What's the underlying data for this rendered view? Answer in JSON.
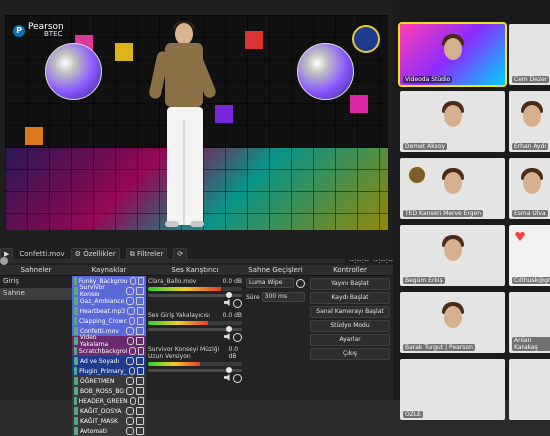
{
  "obs": {
    "logo_text": "Pearson",
    "logo_sub": "BTEC",
    "media_file": "Confetti.mov",
    "properties_label": "Özellikler",
    "filters_label": "Filtreler",
    "timer_left": "--:--:--",
    "timer_right": "--:--:--",
    "panels": {
      "scenes": {
        "title": "Sahneler",
        "items": [
          "Giriş",
          "Sahne"
        ]
      },
      "sources": {
        "title": "Kaynaklar",
        "items": [
          {
            "label": "Funky_Backgrou",
            "color": "#5c6ad9"
          },
          {
            "label": "Survivor Konseı",
            "color": "#5c6ad9"
          },
          {
            "label": "Gaz_Ambiance",
            "color": "#5c6ad9"
          },
          {
            "label": "Heartbeat.mp3",
            "color": "#5c6ad9"
          },
          {
            "label": "Clapping_Crowc",
            "color": "#5c6ad9"
          },
          {
            "label": "Confetti.mov",
            "color": "#5c6ad9"
          },
          {
            "label": "Video Yakalama",
            "color": "#6a2a6e"
          },
          {
            "label": "Scratchbackgroi",
            "color": "#6a2a6e"
          },
          {
            "label": "Ad ve Soyadı",
            "color": "#1e3b8f"
          },
          {
            "label": "Plugin_Primary_",
            "color": "#1e3b8f"
          },
          {
            "label": "ÖĞRETMEN",
            "color": "#3a3a3a"
          },
          {
            "label": "BOB_ROSS_BG",
            "color": "#3a3a3a"
          },
          {
            "label": "HEADER_GREEN",
            "color": "#3a3a3a"
          },
          {
            "label": "KAĞIT_DOSYA",
            "color": "#3a3a3a"
          },
          {
            "label": "KAĞIT_MASK",
            "color": "#3a3a3a"
          },
          {
            "label": "Avtomati",
            "color": "#3a3a3a"
          }
        ]
      },
      "mixer": {
        "title": "Ses Karıştırıcı",
        "items": [
          {
            "label": "Clara_Ballo.mov",
            "db": "0.0 dB",
            "level": 0.78
          },
          {
            "label": "Ses Giriş Yakalayıcısı",
            "db": "0.0 dB",
            "level": 0.64
          },
          {
            "label": "Survivor Konseyi Müziği Uzun Versiyon",
            "db": "0.0 dB",
            "level": 0.55
          }
        ]
      },
      "transitions": {
        "title": "Sahne Geçişleri",
        "selected": "Luma Wipe",
        "duration_label": "Süre",
        "duration_value": "300 ms"
      },
      "controls": {
        "title": "Kontroller",
        "buttons": [
          "Yayını Başlat",
          "Kaydı Başlat",
          "Sanal Kamerayı Başlat",
          "Stüdyo Modu",
          "Ayarlar",
          "Çıkış"
        ]
      }
    }
  },
  "zoom": {
    "participants": [
      {
        "name": "Videoda Stüdio",
        "type": "dancer",
        "active": true
      },
      {
        "name": "Cem Dezer",
        "type": "generic"
      },
      {
        "name": "Demet Aksoy",
        "type": "face"
      },
      {
        "name": "Erhan Aydı",
        "type": "face"
      },
      {
        "name": "TED Kanseri Merve Ergen",
        "type": "face"
      },
      {
        "name": "Esma Ulva",
        "type": "face"
      },
      {
        "name": "Begüm Erkiş",
        "type": "face"
      },
      {
        "name": "Cılthusk@gma",
        "type": "heart"
      },
      {
        "name": "Barak Turgut | Pearson",
        "type": "face"
      },
      {
        "name": "Arılan Karakaş",
        "type": "generic"
      },
      {
        "name": "ÖZLE",
        "type": "generic"
      },
      {
        "name": "",
        "type": "generic"
      }
    ]
  },
  "colors": {
    "accent": "#f3df1d",
    "panel_bg": "#232323",
    "panel_header": "#2d2d2d"
  }
}
